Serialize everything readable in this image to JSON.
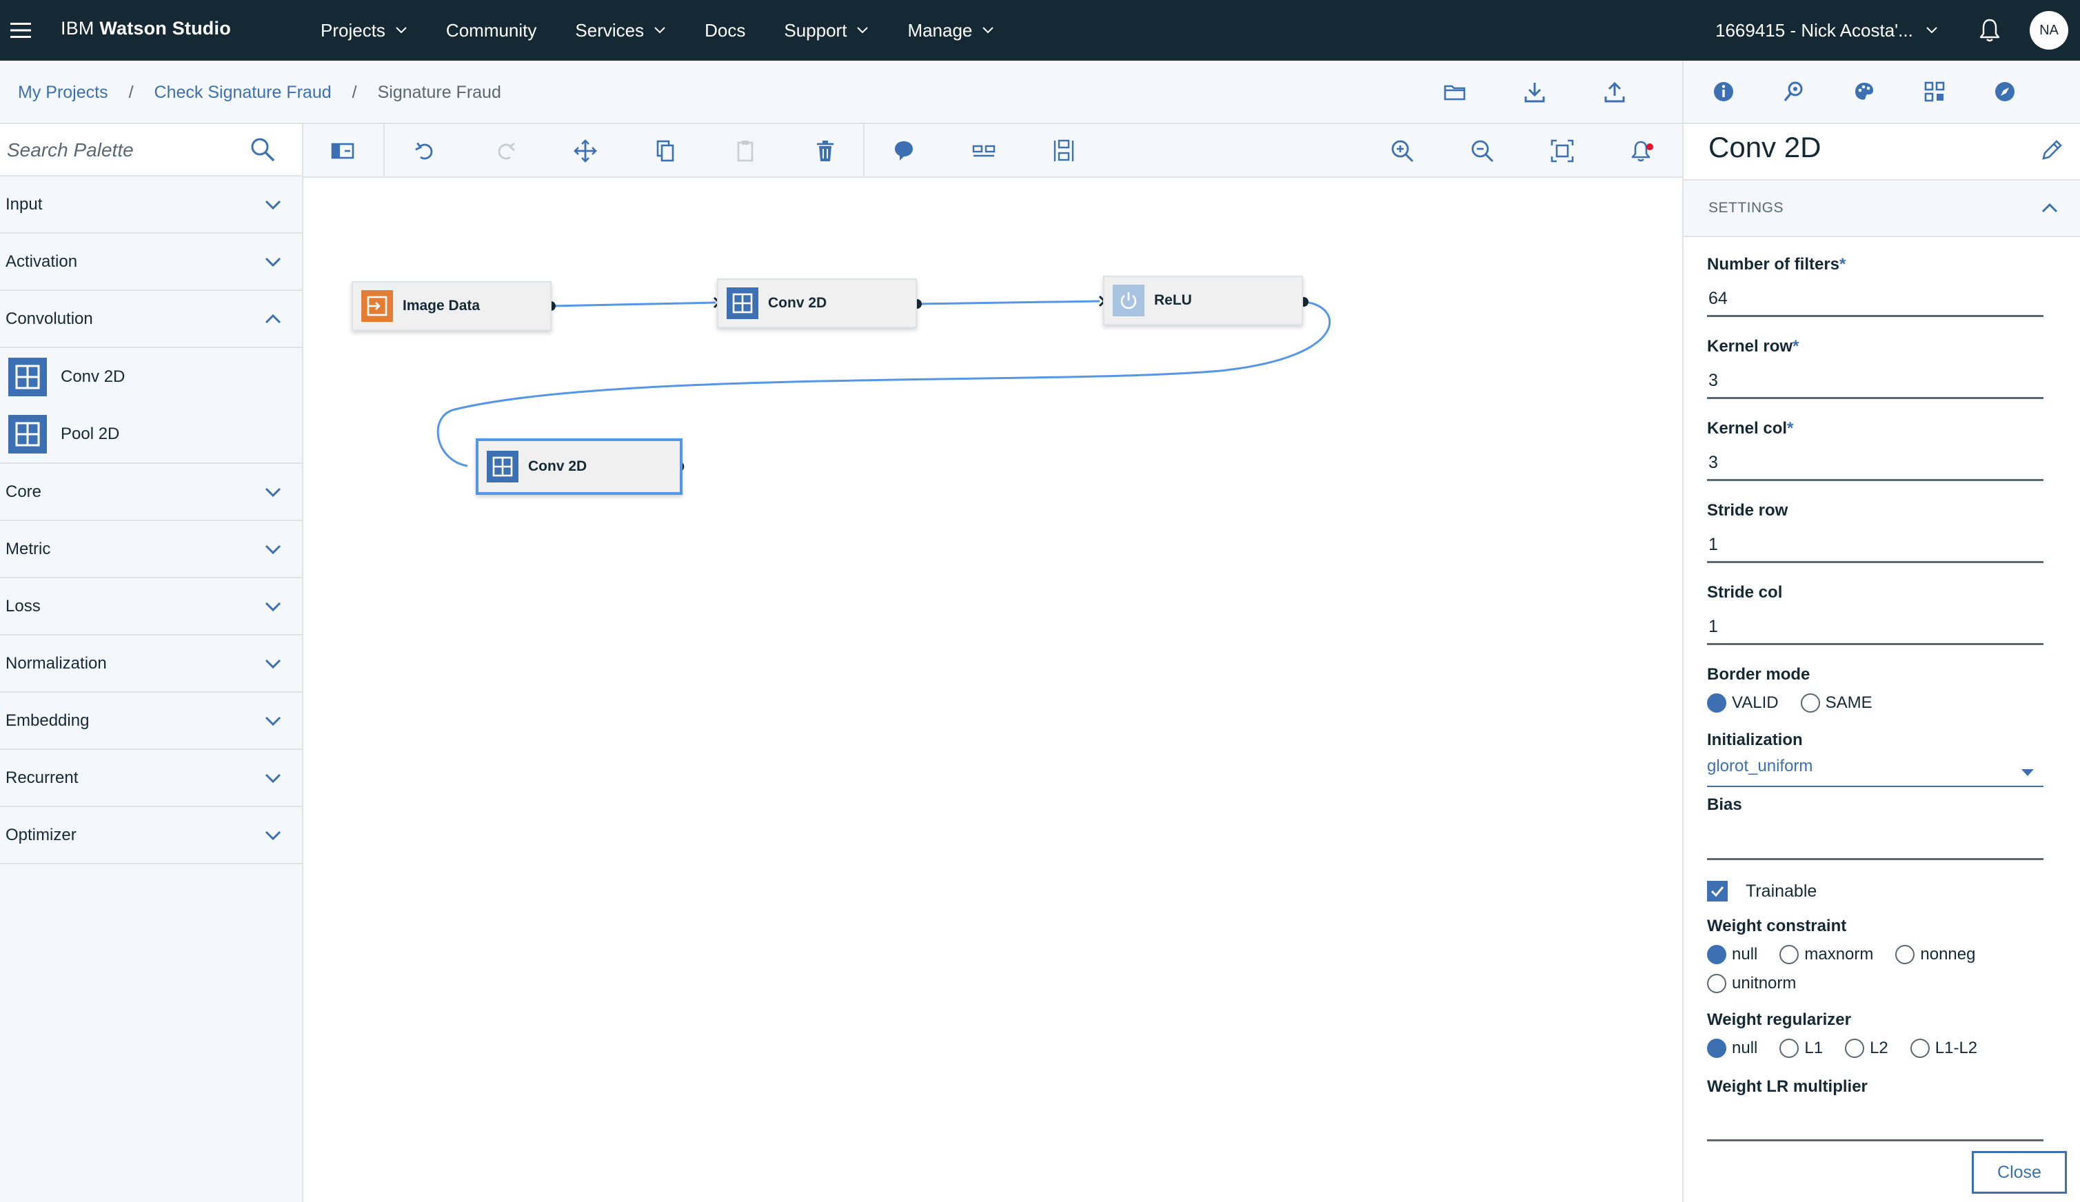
{
  "app": {
    "brand_prefix": "IBM ",
    "brand_name": "Watson Studio"
  },
  "nav": {
    "items": [
      {
        "label": "Projects",
        "has_menu": true
      },
      {
        "label": "Community",
        "has_menu": false
      },
      {
        "label": "Services",
        "has_menu": true
      },
      {
        "label": "Docs",
        "has_menu": false
      },
      {
        "label": "Support",
        "has_menu": true
      },
      {
        "label": "Manage",
        "has_menu": true
      }
    ],
    "account": "1669415 - Nick Acosta'...",
    "avatar_initials": "NA"
  },
  "breadcrumb": {
    "items": [
      "My Projects",
      "Check Signature Fraud"
    ],
    "current": "Signature Fraud",
    "separator": "/"
  },
  "palette": {
    "search_placeholder": "Search Palette",
    "categories": [
      "Input",
      "Activation",
      "Convolution",
      "Core",
      "Metric",
      "Loss",
      "Normalization",
      "Embedding",
      "Recurrent",
      "Optimizer"
    ],
    "expanded": "Convolution",
    "convolution_items": [
      "Conv 2D",
      "Pool 2D"
    ]
  },
  "canvas": {
    "nodes": [
      {
        "label": "Image Data",
        "icon": "data-input-icon",
        "color": "#e37d33"
      },
      {
        "label": "Conv 2D",
        "icon": "grid-icon",
        "color": "#3d70b2"
      },
      {
        "label": "ReLU",
        "icon": "power-icon",
        "color": "#a8c4e0"
      },
      {
        "label": "Conv 2D",
        "icon": "grid-icon",
        "color": "#3d70b2",
        "selected": true
      }
    ]
  },
  "properties": {
    "title": "Conv 2D",
    "section": "SETTINGS",
    "fields": {
      "filters": {
        "label": "Number of filters",
        "required": "*",
        "value": "64"
      },
      "kernel_row": {
        "label": "Kernel row",
        "required": "*",
        "value": "3"
      },
      "kernel_col": {
        "label": "Kernel col",
        "required": "*",
        "value": "3"
      },
      "stride_row": {
        "label": "Stride row",
        "value": "1"
      },
      "stride_col": {
        "label": "Stride col",
        "value": "1"
      },
      "border_mode": {
        "label": "Border mode",
        "options": [
          "VALID",
          "SAME"
        ],
        "selected": "VALID"
      },
      "initialization": {
        "label": "Initialization",
        "value": "glorot_uniform"
      },
      "bias": {
        "label": "Bias",
        "value": ""
      },
      "trainable": {
        "label": "Trainable",
        "checked": true
      },
      "weight_constraint": {
        "label": "Weight constraint",
        "options": [
          "null",
          "maxnorm",
          "nonneg",
          "unitnorm"
        ],
        "selected": "null"
      },
      "weight_regularizer": {
        "label": "Weight regularizer",
        "options": [
          "null",
          "L1",
          "L2",
          "L1-L2"
        ],
        "selected": "null"
      },
      "weight_lr_multiplier": {
        "label": "Weight LR multiplier",
        "value": ""
      }
    },
    "close_label": "Close"
  },
  "colors": {
    "nav_bg": "#152935",
    "accent": "#3d70b2",
    "selection": "#5596e6",
    "input_node": "#e37d33",
    "alert_dot": "#e0182d"
  }
}
